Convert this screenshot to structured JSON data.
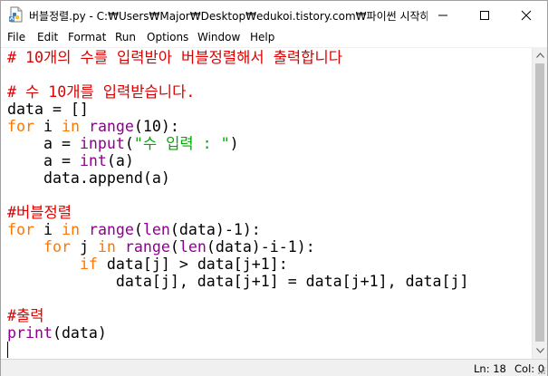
{
  "window": {
    "title": "버블정렬.py - C:₩Users₩Major₩Desktop₩edukoi.tistory.com₩파이썬 시작하기..."
  },
  "menu": {
    "items": [
      "File",
      "Edit",
      "Format",
      "Run",
      "Options",
      "Window",
      "Help"
    ]
  },
  "editor": {
    "syntax_colors": {
      "comment": "#dd0000",
      "keyword": "#ff7700",
      "builtin": "#900090",
      "string": "#00aa00",
      "default": "#000000"
    },
    "lines": [
      [
        {
          "t": "comment",
          "v": "# 10개의 수를 입력받아 버블정렬해서 출력합니다"
        }
      ],
      [],
      [
        {
          "t": "comment",
          "v": "# 수 10개를 입력받습니다."
        }
      ],
      [
        {
          "t": "default",
          "v": "data = []"
        }
      ],
      [
        {
          "t": "keyword",
          "v": "for"
        },
        {
          "t": "default",
          "v": " i "
        },
        {
          "t": "keyword",
          "v": "in"
        },
        {
          "t": "default",
          "v": " "
        },
        {
          "t": "builtin",
          "v": "range"
        },
        {
          "t": "default",
          "v": "(10):"
        }
      ],
      [
        {
          "t": "default",
          "v": "    a = "
        },
        {
          "t": "builtin",
          "v": "input"
        },
        {
          "t": "default",
          "v": "("
        },
        {
          "t": "string",
          "v": "\"수 입력 : \""
        },
        {
          "t": "default",
          "v": ")"
        }
      ],
      [
        {
          "t": "default",
          "v": "    a = "
        },
        {
          "t": "builtin",
          "v": "int"
        },
        {
          "t": "default",
          "v": "(a)"
        }
      ],
      [
        {
          "t": "default",
          "v": "    data.append(a)"
        }
      ],
      [],
      [
        {
          "t": "comment",
          "v": "#버블정렬"
        }
      ],
      [
        {
          "t": "keyword",
          "v": "for"
        },
        {
          "t": "default",
          "v": " i "
        },
        {
          "t": "keyword",
          "v": "in"
        },
        {
          "t": "default",
          "v": " "
        },
        {
          "t": "builtin",
          "v": "range"
        },
        {
          "t": "default",
          "v": "("
        },
        {
          "t": "builtin",
          "v": "len"
        },
        {
          "t": "default",
          "v": "(data)-1):"
        }
      ],
      [
        {
          "t": "default",
          "v": "    "
        },
        {
          "t": "keyword",
          "v": "for"
        },
        {
          "t": "default",
          "v": " j "
        },
        {
          "t": "keyword",
          "v": "in"
        },
        {
          "t": "default",
          "v": " "
        },
        {
          "t": "builtin",
          "v": "range"
        },
        {
          "t": "default",
          "v": "("
        },
        {
          "t": "builtin",
          "v": "len"
        },
        {
          "t": "default",
          "v": "(data)-i-1):"
        }
      ],
      [
        {
          "t": "default",
          "v": "        "
        },
        {
          "t": "keyword",
          "v": "if"
        },
        {
          "t": "default",
          "v": " data[j] > data[j+1]:"
        }
      ],
      [
        {
          "t": "default",
          "v": "            data[j], data[j+1] = data[j+1], data[j]"
        }
      ],
      [],
      [
        {
          "t": "comment",
          "v": "#출력"
        }
      ],
      [
        {
          "t": "builtin",
          "v": "print"
        },
        {
          "t": "default",
          "v": "(data)"
        }
      ],
      []
    ]
  },
  "status": {
    "line": "Ln: 18",
    "col": "Col: 0"
  }
}
